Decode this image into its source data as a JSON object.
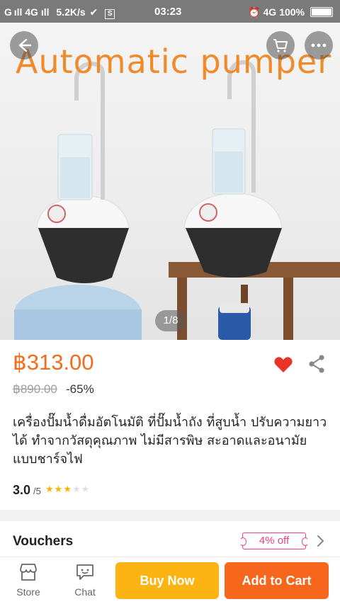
{
  "status_bar": {
    "network": "G ıll 4G ıll",
    "speed": "5.2K/s",
    "time": "03:23",
    "right": "4G",
    "battery": "100%"
  },
  "hero": {
    "banner_text": "Automatic pumper",
    "image_counter": "1/8",
    "icons": [
      "back-icon",
      "cart-icon",
      "more-icon"
    ]
  },
  "product": {
    "price": "฿313.00",
    "original_price": "฿890.00",
    "discount": "-65%",
    "title": "เครื่องปั๊มน้ำดื่มอัตโนมัติ ที่ปั๊มน้ำถัง ที่สูบน้ำ ปรับความยาวได้ ทำจากวัสดุคุณภาพ ไม่มีสารพิษ สะอาดและอนามัย แบบชาร์จไฟ",
    "rating": "3.0",
    "rating_max": "/5",
    "stars_filled": 3,
    "stars_total": 5
  },
  "vouchers": {
    "label": "Vouchers",
    "tag": "4% off"
  },
  "bottom_bar": {
    "store_label": "Store",
    "chat_label": "Chat",
    "buy_now_label": "Buy Now",
    "add_to_cart_label": "Add to Cart"
  },
  "colors": {
    "price": "#f36b1c",
    "buy_now": "#fbb414",
    "add_to_cart": "#f6661d",
    "voucher": "#f0408a",
    "wishlist": "#e8352a"
  }
}
